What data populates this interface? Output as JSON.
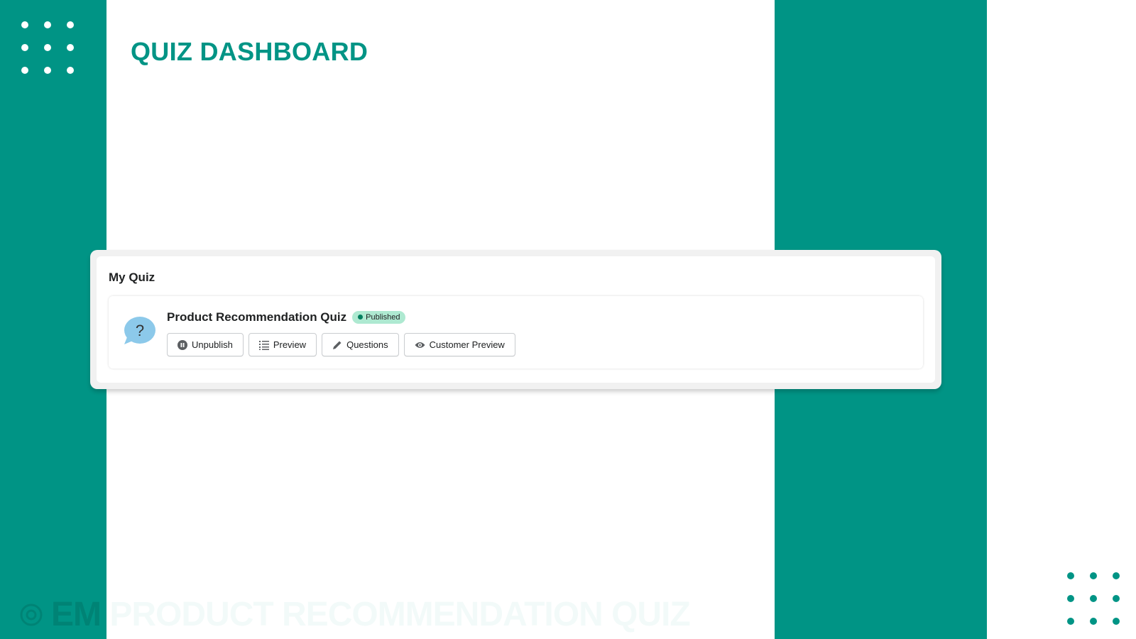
{
  "header": {
    "title": "QUIZ DASHBOARD"
  },
  "card": {
    "title": "My Quiz",
    "quiz": {
      "name": "Product Recommendation Quiz",
      "status": "Published",
      "icon": "question-bubble-icon",
      "buttons": [
        {
          "label": "Unpublish",
          "icon": "pause-circle-icon"
        },
        {
          "label": "Preview",
          "icon": "list-icon"
        },
        {
          "label": "Questions",
          "icon": "pencil-icon"
        },
        {
          "label": "Customer Preview",
          "icon": "eye-icon"
        }
      ]
    }
  },
  "watermark": {
    "brand": "EM",
    "text": "PRODUCT RECOMMENDATION QUIZ"
  },
  "colors": {
    "accent": "#009485",
    "badge": "#aee9d1",
    "icon": "#8cc9ea"
  }
}
